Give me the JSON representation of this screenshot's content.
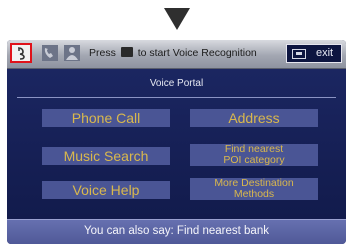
{
  "topbar": {
    "press_prefix": "Press",
    "press_suffix": "to start Voice Recognition",
    "exit_label": "exit"
  },
  "portal": {
    "title": "Voice Portal",
    "options": {
      "phone_call": "Phone Call",
      "address": "Address",
      "music_search": "Music Search",
      "find_poi_line1": "Find nearest",
      "find_poi_line2": "POI category",
      "voice_help": "Voice Help",
      "more_dest_line1": "More Destination",
      "more_dest_line2": "Methods"
    }
  },
  "bottom": {
    "hint": "You can also say: Find nearest bank"
  },
  "icons": [
    "down-arrow-icon",
    "voice-command-icon",
    "phone-icon",
    "person-icon",
    "talk-key-icon",
    "exit-icon"
  ],
  "colors": {
    "highlight_border": "#e0121a",
    "option_text": "#d9b84d",
    "option_bg": "#4a5595",
    "screen_bg": "#0d1540"
  }
}
